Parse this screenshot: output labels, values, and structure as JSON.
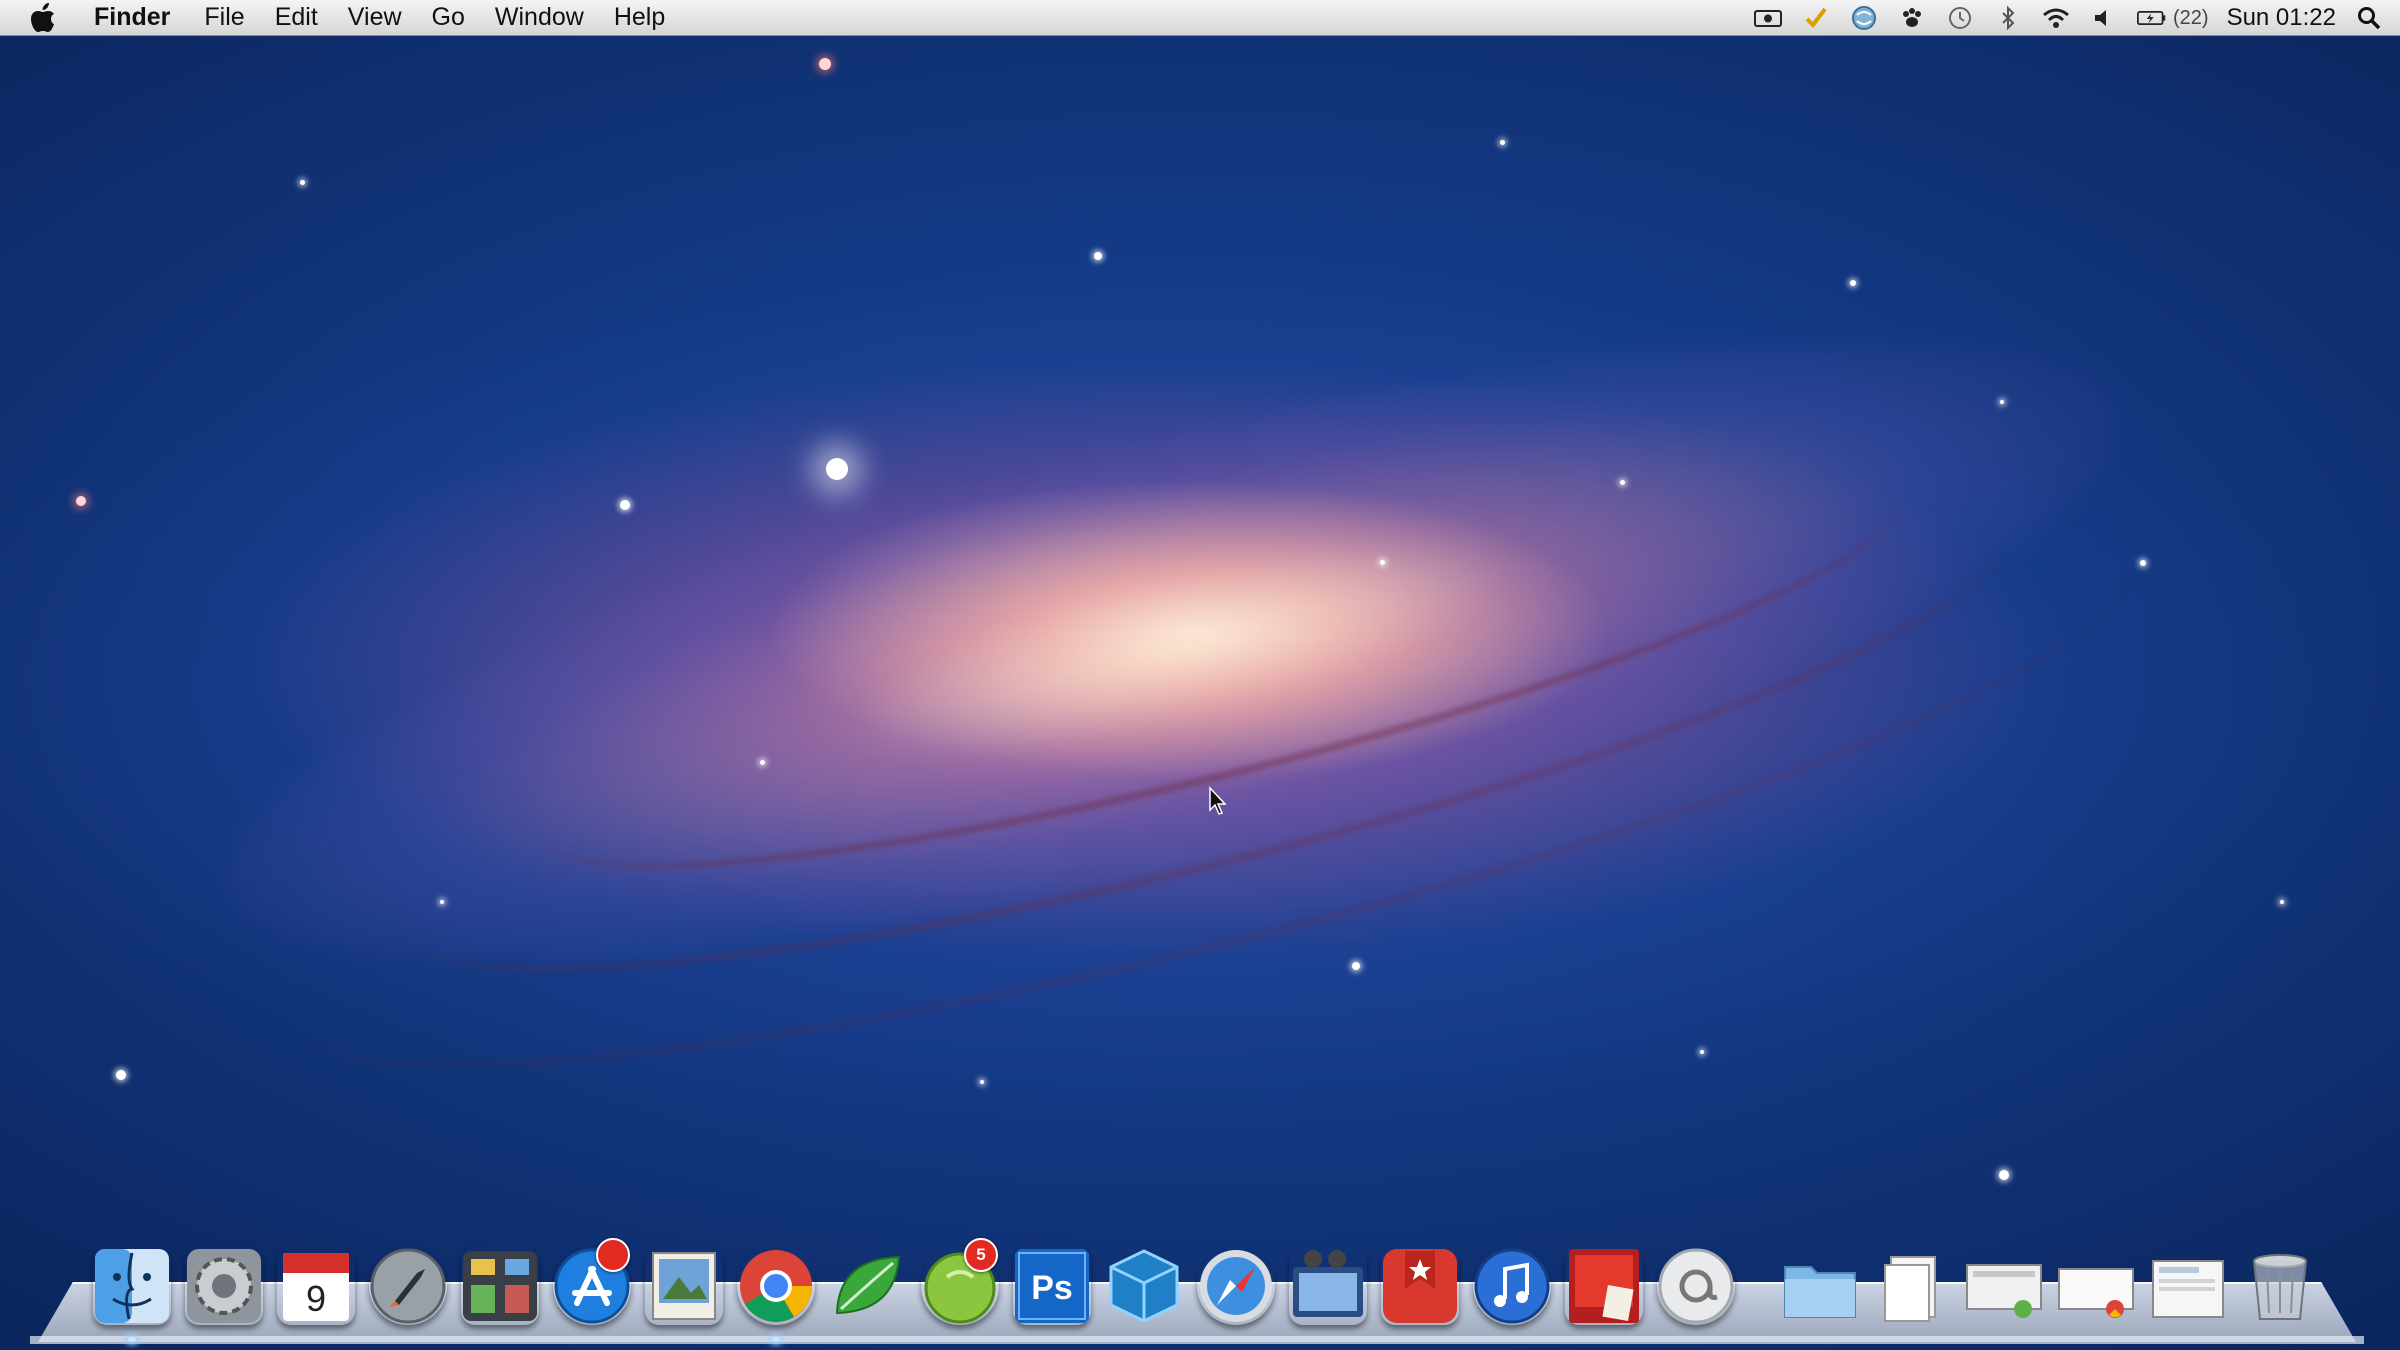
{
  "menubar": {
    "apple_icon": "apple-logo-icon",
    "app_name": "Finder",
    "items": [
      "File",
      "Edit",
      "View",
      "Go",
      "Window",
      "Help"
    ],
    "status": {
      "battery_text": "(22)",
      "clock": "Sun 01:22"
    }
  },
  "dock": {
    "apps": [
      {
        "name": "finder",
        "icon": "finder-icon"
      },
      {
        "name": "system-preferences",
        "icon": "gear-icon"
      },
      {
        "name": "calendar",
        "icon": "calendar-icon",
        "label": "9"
      },
      {
        "name": "launchpad",
        "icon": "rocket-icon"
      },
      {
        "name": "mission-control",
        "icon": "mission-control-icon"
      },
      {
        "name": "app-store",
        "icon": "app-store-icon",
        "badge_visible": true
      },
      {
        "name": "preview",
        "icon": "preview-icon"
      },
      {
        "name": "chrome",
        "icon": "chrome-icon"
      },
      {
        "name": "leaf",
        "icon": "leaf-icon"
      },
      {
        "name": "lime",
        "icon": "lime-icon",
        "badge": "5"
      },
      {
        "name": "photoshop",
        "icon": "photoshop-icon",
        "label": "Ps"
      },
      {
        "name": "virtualbox",
        "icon": "cube-icon"
      },
      {
        "name": "safari",
        "icon": "compass-icon"
      },
      {
        "name": "imovie",
        "icon": "film-icon"
      },
      {
        "name": "wunderlist",
        "icon": "star-bookmark-icon"
      },
      {
        "name": "itunes",
        "icon": "music-note-icon"
      },
      {
        "name": "photo-booth",
        "icon": "photo-booth-icon"
      },
      {
        "name": "contacts",
        "icon": "at-sign-icon"
      }
    ],
    "stacks": [
      {
        "name": "applications-folder",
        "icon": "folder-icon"
      },
      {
        "name": "documents-stack",
        "icon": "document-icon"
      },
      {
        "name": "downloads-stack-1",
        "icon": "document-stack-icon"
      },
      {
        "name": "downloads-stack-2",
        "icon": "document-stack-icon"
      },
      {
        "name": "downloads-stack-3",
        "icon": "document-stack-icon"
      },
      {
        "name": "trash",
        "icon": "trash-icon"
      }
    ]
  },
  "colors": {
    "wallpaper_space": "#143a86",
    "galaxy_core": "#ffe8d2",
    "menubar_top": "#f4f4f4",
    "menubar_bottom": "#d6d6d6",
    "badge_red": "#e32a22"
  }
}
